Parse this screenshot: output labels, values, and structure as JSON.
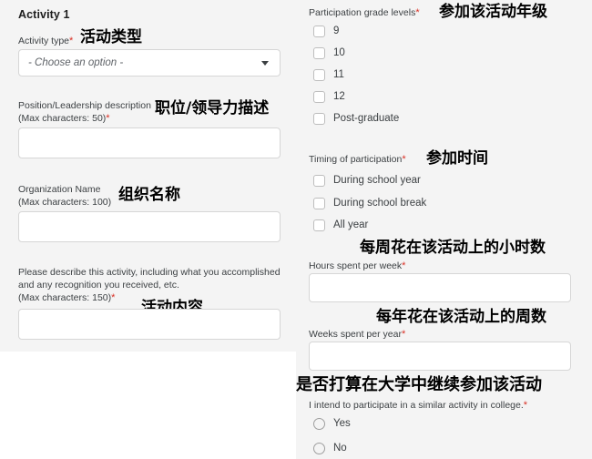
{
  "form": {
    "left": {
      "section_title": "Activity 1",
      "activity_type": {
        "label": "Activity type",
        "required": true,
        "placeholder": "- Choose an option -",
        "value": "",
        "annotation_cn": "活动类型"
      },
      "position_description": {
        "label": "Position/Leadership description\n(Max characters: 50)",
        "required": true,
        "value": "",
        "annotation_cn": "职位/领导力描述"
      },
      "organization_name": {
        "label": "Organization Name\n(Max characters: 100)",
        "required": false,
        "value": "",
        "annotation_cn": "组织名称"
      },
      "activity_description": {
        "label": "Please describe this activity, including what you accomplished\nand any recognition you received, etc.\n(Max characters: 150)",
        "required": true,
        "value": "",
        "annotation_cn": "活动内容"
      }
    },
    "right": {
      "grade_levels": {
        "label": "Participation grade levels",
        "required": true,
        "annotation_cn": "参加该活动年级",
        "options": [
          {
            "label": "9",
            "checked": false
          },
          {
            "label": "10",
            "checked": false
          },
          {
            "label": "11",
            "checked": false
          },
          {
            "label": "12",
            "checked": false
          },
          {
            "label": "Post-graduate",
            "checked": false
          }
        ]
      },
      "timing": {
        "label": "Timing of participation",
        "required": true,
        "annotation_cn": "参加时间",
        "options": [
          {
            "label": "During school year",
            "checked": false
          },
          {
            "label": "During school break",
            "checked": false
          },
          {
            "label": "All year",
            "checked": false
          }
        ]
      },
      "hours_per_week": {
        "label": "Hours spent per week",
        "required": true,
        "value": "",
        "annotation_cn": "每周花在该活动上的小时数"
      },
      "weeks_per_year": {
        "label": "Weeks spent per year",
        "required": true,
        "value": "",
        "annotation_cn": "每年花在该活动上的周数"
      },
      "college_intent": {
        "label": "I intend to participate in a similar activity in college.",
        "required": true,
        "annotation_cn": "是否打算在大学中继续参加该活动",
        "options": [
          {
            "label": "Yes",
            "selected": false
          },
          {
            "label": "No",
            "selected": false
          }
        ]
      }
    }
  },
  "colors": {
    "panel_background": "#f4f4f4",
    "page_background": "#ffffff",
    "input_background": "#ffffff",
    "input_border": "#d6d6d6",
    "required_asterisk": "#d93025",
    "label_text": "#3c4043",
    "annotation_text": "#000000"
  }
}
